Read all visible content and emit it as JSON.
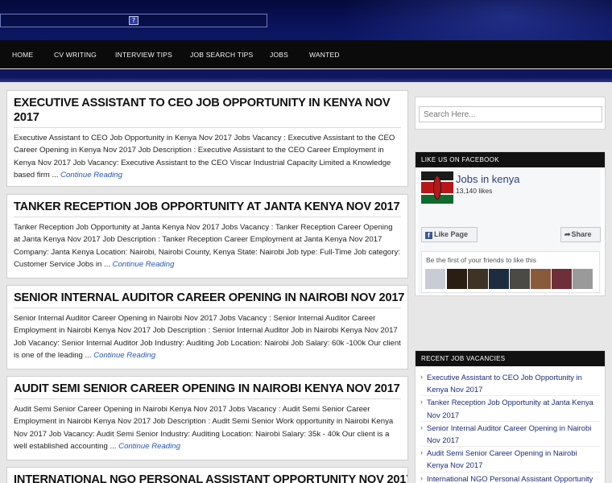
{
  "nav": {
    "items": [
      "HOME",
      "CV WRITING",
      "INTERVIEW TIPS",
      "JOB SEARCH TIPS",
      "JOBS",
      "WANTED"
    ]
  },
  "banner": {
    "icon_glyph": "?"
  },
  "posts": [
    {
      "title": "EXECUTIVE ASSISTANT TO CEO JOB OPPORTUNITY IN KENYA NOV 2017",
      "excerpt": "Executive Assistant to CEO Job Opportunity in Kenya Nov 2017   Jobs Vacancy : Executive Assistant to the CEO Career Opening in Kenya Nov 2017   Job Description : Executive Assistant to the CEO Career Employment in Kenya Nov 2017   Job Vacancy: Executive Assistant to the CEO   Viscar Industrial Capacity Limited a Knowledge based firm ...",
      "read_more": "Continue Reading"
    },
    {
      "title": "TANKER RECEPTION JOB OPPORTUNITY AT JANTA KENYA NOV 2017",
      "excerpt": "Tanker Reception Job Opportunity at Janta Kenya Nov 2017   Jobs Vacancy : Tanker Reception Career Opening at Janta Kenya Nov 2017   Job Description : Tanker Reception Career Employment at Janta Kenya Nov 2017   Company: Janta Kenya Location: Nairobi, Nairobi County, Kenya State: Nairobi Job type: Full-Time Job category: Customer Service Jobs in ...",
      "read_more": "Continue Reading"
    },
    {
      "title": "SENIOR INTERNAL AUDITOR CAREER OPENING IN NAIROBI NOV 2017",
      "excerpt": "Senior Internal Auditor Career Opening in Nairobi  Nov 2017   Jobs Vacancy : Senior Internal Auditor Career Employment in Nairobi Kenya Nov 2017   Job Description : Senior Internal Auditor Job in Nairobi Kenya Nov 2017   Job Vacancy: Senior Internal Auditor Job Industry: Auditing   Job Location: Nairobi   Job Salary: 60k -100k Our client is one of the leading ...",
      "read_more": "Continue Reading"
    },
    {
      "title": "AUDIT SEMI SENIOR CAREER OPENING IN NAIROBI KENYA NOV 2017",
      "excerpt": "Audit Semi Senior Career Opening in Nairobi Kenya Nov 2017   Jobs Vacancy : Audit Semi Senior Career Employment in Nairobi Kenya Nov 2017   Job Description : Audit Semi Senior Work opportunity in Nairobi Kenya Nov 2017   Job Vacancy: Audit Semi Senior Industry: Auditing   Location: Nairobi   Salary: 35k - 40k Our client is a well established accounting ...",
      "read_more": "Continue Reading"
    },
    {
      "title": "INTERNATIONAL NGO PERSONAL ASSISTANT OPPORTUNITY NOV 2017",
      "excerpt": "",
      "read_more": ""
    }
  ],
  "sidebar": {
    "search_placeholder": "Search Here...",
    "facebook": {
      "header": "LIKE US ON FACEBOOK",
      "page_name": "Jobs in kenya",
      "likes": "13,140 likes",
      "like_button": "Like Page",
      "share_button": "Share",
      "friends_text": "Be the first of your friends to like this",
      "flag_colors": [
        "#1a1a1a",
        "#ffffff",
        "#b8161b",
        "#ffffff",
        "#0f6b2e"
      ]
    },
    "recent": {
      "header": "RECENT JOB VACANCIES",
      "items": [
        "Executive Assistant to CEO Job Opportunity in Kenya Nov 2017",
        "Tanker Reception Job Opportunity at Janta Kenya Nov 2017",
        "Senior Internal Auditor Career Opening in Nairobi Nov 2017",
        "Audit Semi Senior Career Opening in Nairobi Kenya Nov 2017",
        "International NGO Personal Assistant Opportunity"
      ]
    }
  },
  "colors": {
    "nav_bg": "#0b0b0b",
    "header_bg": "#0a1258",
    "link": "#2456b8"
  }
}
